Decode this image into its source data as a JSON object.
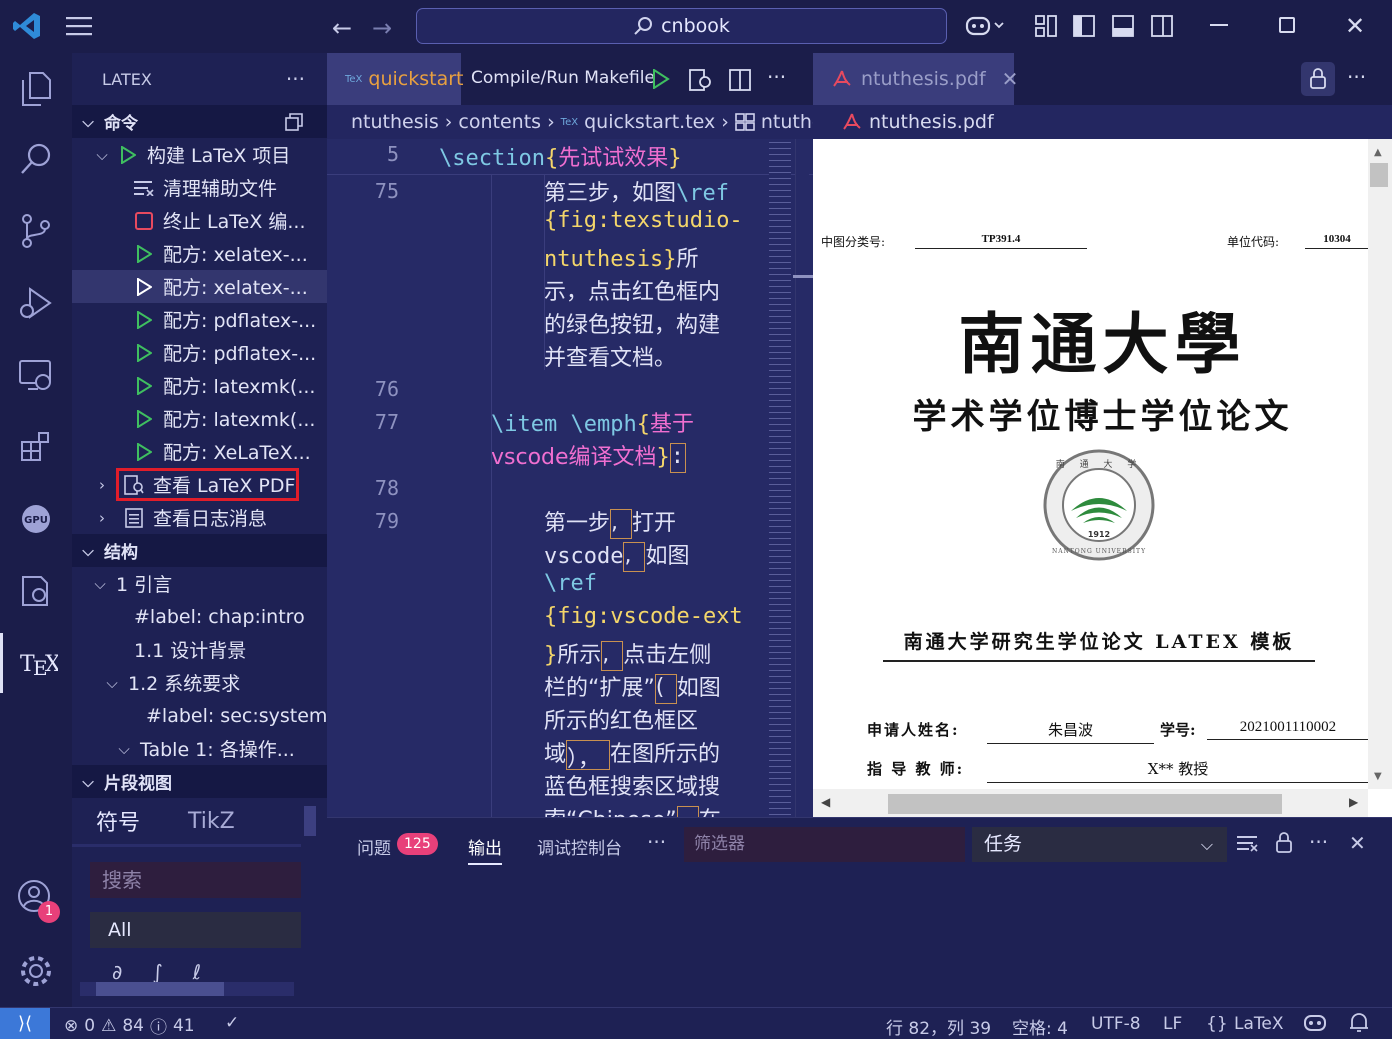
{
  "titlebar": {
    "search_text": "cnbook"
  },
  "sidebar": {
    "header": "LATEX",
    "commands": {
      "title": "命令",
      "build": "构建 LaTeX 项目",
      "items": [
        "清理辅助文件",
        "终止 LaTeX 编...",
        "配方: xelatex-...",
        "配方: xelatex-...",
        "配方: pdflatex-...",
        "配方: pdflatex-...",
        "配方: latexmk(...",
        "配方: latexmk(...",
        "配方: XeLaTeX..."
      ],
      "view_pdf": "查看 LaTeX PDF",
      "view_log": "查看日志消息"
    },
    "structure": {
      "title": "结构",
      "items": [
        "1 引言",
        "#label: chap:intro",
        "1.1 设计背景",
        "1.2 系统要求",
        "#label: sec:system",
        "Table 1: 各操作..."
      ]
    },
    "snippets": {
      "title": "片段视图",
      "tabs": [
        "符号",
        "TikZ"
      ],
      "search_placeholder": "搜索",
      "filter_value": "All"
    }
  },
  "editor": {
    "tab_label": "quickstart",
    "compile_label": "Compile/Run Makefile",
    "breadcrumb": [
      "ntuthesis",
      "contents",
      "quickstart.tex",
      "ntuthes"
    ],
    "lines": {
      "l5": "5",
      "l75": "75",
      "l76": "76",
      "l77": "77",
      "l78": "78",
      "l79": "79"
    },
    "code": {
      "section_cmd": "\\section",
      "section_arg": "先试试效果",
      "c75a": "第三步，如图",
      "ref": "\\ref",
      "c75b": "fig:texstudio-",
      "c75c": "ntuthesis",
      "c75c2": "所",
      "c75d": "示，点击红色框内",
      "c75e": "的绿色按钮，构建",
      "c75f": "并查看文档。",
      "item": "\\item",
      "emph": "\\emph",
      "c77a": "基于",
      "c77b": "vscode编译文档",
      "c79a": "第一步",
      "c79a2": "打开",
      "c79b": "vscode",
      "c79b2": "如图",
      "c79c": "\\ref",
      "c79d": "fig:vscode-ext",
      "c79e": "所示",
      "c79e2": "点击左侧",
      "c79f": "栏的“扩展”",
      "c79f2": "如图",
      "c79g": "所示的红色框区",
      "c79h": "域",
      "c79h2": "在图所示的",
      "c79i": "蓝色框搜索区域搜",
      "c79j": "索“Chinese”",
      "c79j2": "在"
    }
  },
  "pdf": {
    "tab_label": "ntuthesis.pdf",
    "breadcrumb": "ntuthesis.pdf",
    "class_label": "中图分类号:",
    "class_value": "TP391.4",
    "unit_label": "单位代码:",
    "unit_value": "10304",
    "university": "南通大學",
    "subtitle": "学术学位博士学位论文",
    "seal_year": "1912",
    "seal_text": "NANTONG UNIVERSITY",
    "seal_chars": "南 通 大 学",
    "thesis_title": "南通大学研究生学位论文 LATEX 模板",
    "applicant_label": "申请人姓名:",
    "applicant_value": "朱昌波",
    "id_label": "学号:",
    "id_value": "2021001110002",
    "advisor_label": "指 导 教 师:",
    "advisor_value": "X** 教授"
  },
  "panel": {
    "tabs": [
      "问题",
      "输出",
      "调试控制台"
    ],
    "problems_count": "125",
    "filter_placeholder": "筛选器",
    "dropdown_value": "任务"
  },
  "status": {
    "errors": "0",
    "warnings": "84",
    "infos": "41",
    "position": "行 82，列 39",
    "spaces": "空格: 4",
    "encoding": "UTF-8",
    "eol": "LF",
    "language": "LaTeX",
    "account_badge": "1"
  },
  "colors": {
    "accent": "#3c78d8",
    "green": "#3fbf60",
    "red_box": "#e11d2a",
    "badge": "#e8407a"
  }
}
